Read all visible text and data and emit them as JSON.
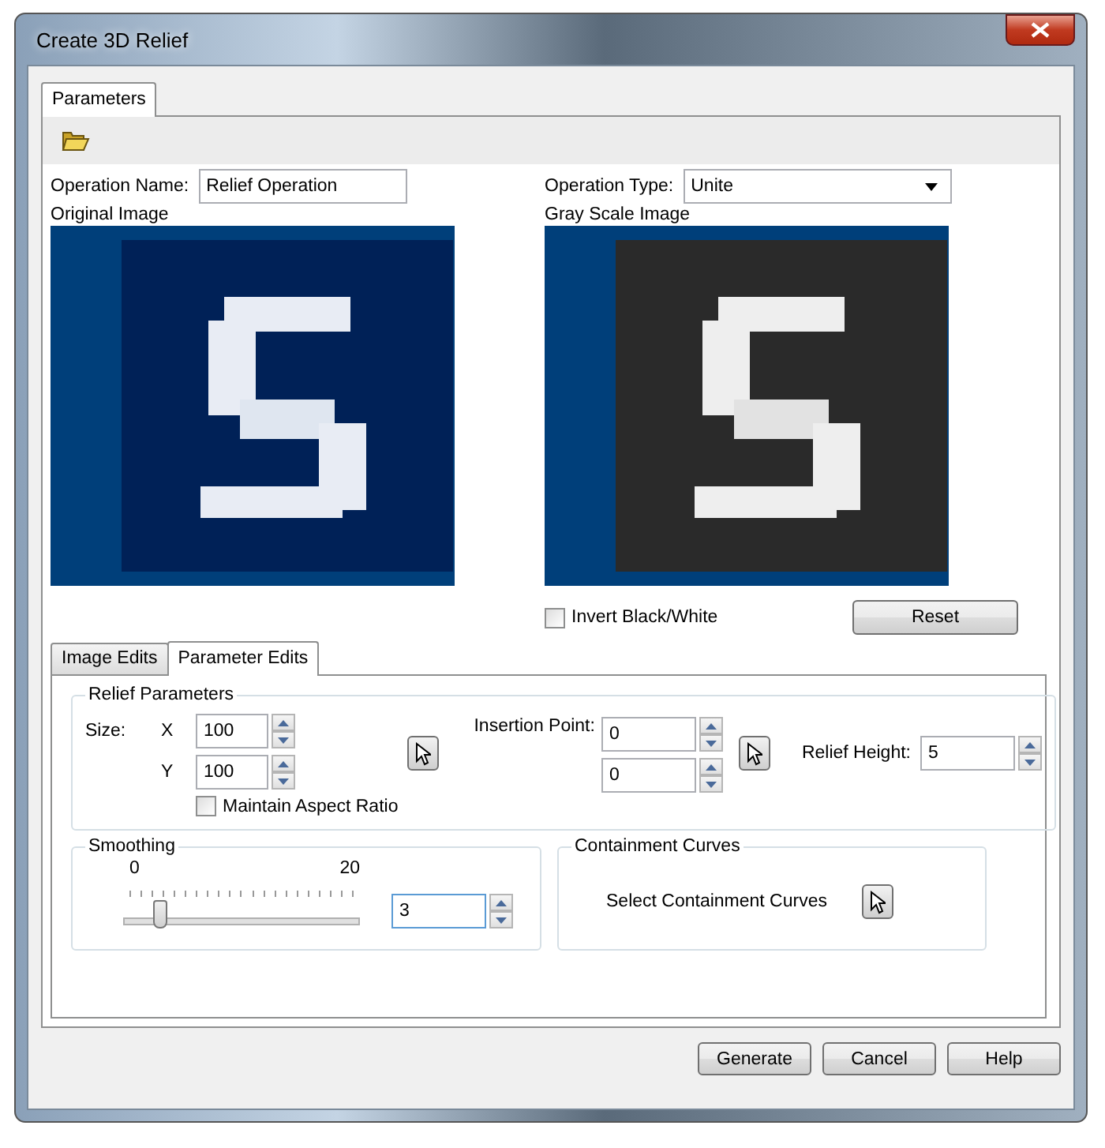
{
  "window": {
    "title": "Create 3D Relief"
  },
  "tabs": [
    {
      "label": "Parameters",
      "selected": true
    }
  ],
  "operation_name": {
    "label": "Operation Name:",
    "value": "Relief Operation"
  },
  "operation_type": {
    "label": "Operation Type:",
    "value": "Unite"
  },
  "original_image": {
    "label": "Original Image",
    "kind": "picture"
  },
  "gray_scale_image": {
    "label": "Gray Scale Image",
    "kind": "picture"
  },
  "invert": {
    "label": "Invert Black/White",
    "checked": false
  },
  "reset_button": "Reset",
  "edit_tabs": [
    {
      "label": "Image Edits",
      "selected": false
    },
    {
      "label": "Parameter Edits",
      "selected": true
    }
  ],
  "relief_parameters": {
    "title": "Relief Parameters",
    "size_label": "Size:",
    "x_label": "X",
    "x_value": "100",
    "y_label": "Y",
    "y_value": "100",
    "maintain_aspect_ratio": {
      "label": "Maintain Aspect Ratio",
      "checked": false
    },
    "insertion_point": {
      "label": "Insertion Point:",
      "values": [
        "0",
        "0"
      ]
    },
    "relief_height": {
      "label": "Relief Height:",
      "value": "5"
    }
  },
  "smoothing": {
    "title": "Smoothing",
    "min": "0",
    "max": "20",
    "level": 0.15,
    "value": "3"
  },
  "containment_curves": {
    "title": "Containment Curves",
    "label": "Select Containment Curves"
  },
  "buttons": [
    "Generate",
    "Cancel",
    "Help"
  ]
}
